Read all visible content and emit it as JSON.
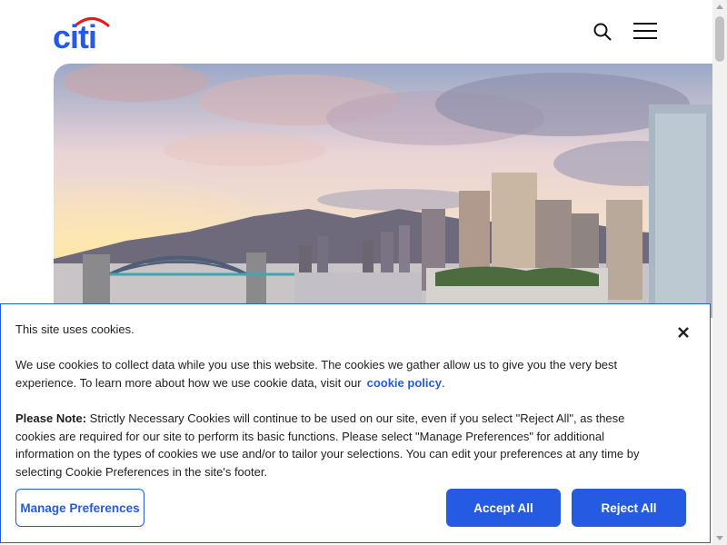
{
  "header": {
    "logo_text": "citi",
    "search_icon": "search-icon",
    "menu_icon": "hamburger-menu-icon"
  },
  "hero": {
    "image": "vancouver-skyline-sunset"
  },
  "cookie_banner": {
    "intro": "This site uses cookies.",
    "paragraph1_text": "We use cookies to collect data while you use this website. The cookies we gather allow us to give you the very best experience. To learn more about how we use cookie data, visit our",
    "paragraph1_link": "cookie policy",
    "paragraph1_end": ".",
    "note_label": "Please Note:",
    "note_text": " Strictly Necessary Cookies will continue to be used on our site, even if you select \"Reject All\", as these cookies are required for our site to perform its basic functions. Please select \"Manage Preferences\" for additional information on the types of cookies we use and/or to tailor your selections. You can edit your preferences at any time by selecting Cookie Preferences in the site's footer.",
    "manage_label": "Manage Preferences",
    "accept_label": "Accept All",
    "reject_label": "Reject All"
  },
  "colors": {
    "brand_blue": "#255be3",
    "logo_arc_red": "#e21c25"
  }
}
